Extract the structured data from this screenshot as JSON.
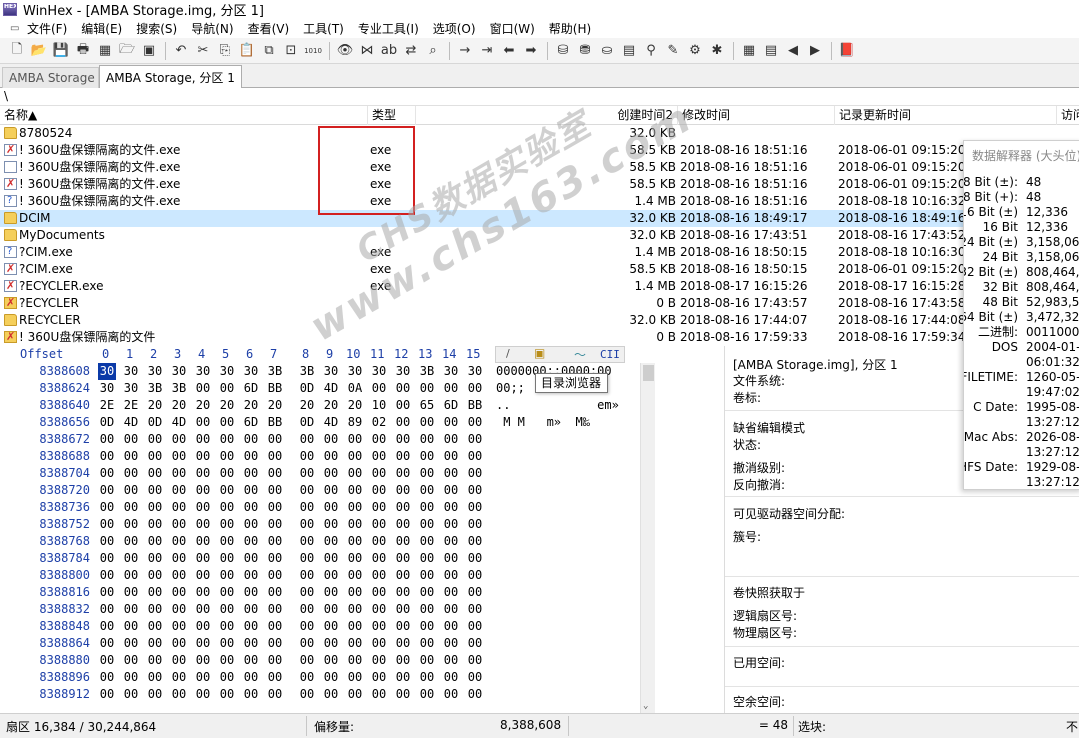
{
  "window": {
    "title": "WinHex - [AMBA Storage.img, 分区 1]",
    "app_icon_text": "HEX"
  },
  "menu": [
    {
      "label": "文件(F)",
      "icon": "file-menu-icon"
    },
    {
      "label": "编辑(E)",
      "icon": ""
    },
    {
      "label": "搜索(S)",
      "icon": ""
    },
    {
      "label": "导航(N)",
      "icon": ""
    },
    {
      "label": "查看(V)",
      "icon": ""
    },
    {
      "label": "工具(T)",
      "icon": ""
    },
    {
      "label": "专业工具(I)",
      "icon": ""
    },
    {
      "label": "选项(O)",
      "icon": ""
    },
    {
      "label": "窗口(W)",
      "icon": ""
    },
    {
      "label": "帮助(H)",
      "icon": ""
    }
  ],
  "toolbar": {
    "icons": [
      "new-file-icon",
      "open-folder-icon",
      "save-icon",
      "print-icon",
      "properties-icon",
      "open-disk-icon",
      "save-all-icon",
      "sep",
      "undo-icon",
      "cut-icon",
      "copy-icon",
      "paste-icon",
      "copy-block-icon",
      "paste-zero-icon",
      "write-hex-icon",
      "sep",
      "find-icon",
      "find-hex-icon",
      "replace-icon",
      "replace-hex-icon",
      "find-all-icon",
      "sep",
      "goto-offset-icon",
      "goto-sector-icon",
      "back-icon",
      "forward-icon",
      "sep",
      "disk-icon",
      "ram-icon",
      "drive-icon",
      "calculator-icon",
      "zoom-icon",
      "tools-icon",
      "hash-icon",
      "gear-icon",
      "sep",
      "grid-icon",
      "table-icon",
      "prev-icon",
      "next-icon",
      "sep",
      "book-icon"
    ],
    "glyphs": [
      "🗋",
      "📂",
      "💾",
      "🖶",
      "▦",
      "🗁",
      "▣",
      "",
      "↶",
      "✂",
      "⎘",
      "📋",
      "⧉",
      "⊡",
      "1010",
      "",
      "👁",
      "⋈",
      "ab",
      "⇄",
      "⌕",
      "",
      "→",
      "⇥",
      "⬅",
      "➡",
      "",
      "⛁",
      "⛃",
      "⛀",
      "▤",
      "⚲",
      "✎",
      "⚙",
      "✱",
      "",
      "▦",
      "▤",
      "◀",
      "▶",
      "",
      "📕"
    ]
  },
  "tabs": [
    {
      "label": "AMBA Storage",
      "active": false
    },
    {
      "label": "AMBA Storage, 分区 1",
      "active": true
    }
  ],
  "path": "\\",
  "filelist": {
    "headers": [
      "名称▲",
      "类型",
      "创建时间2",
      "修改时间",
      "记录更新时间",
      "访问"
    ],
    "rows": [
      {
        "icon": "folder",
        "name": "8780524",
        "type": "",
        "size": "32.0 KB",
        "created": "",
        "modified": "",
        "record": "",
        "sel": false
      },
      {
        "icon": "file-x",
        "name": "! 360U盘保镖隔离的文件.exe",
        "type": "exe",
        "size": "58.5 KB",
        "created": "2018-08-16  18:51:16",
        "modified": "2018-06-01  09:15:20",
        "record": "",
        "sel": false
      },
      {
        "icon": "file",
        "name": "! 360U盘保镖隔离的文件.exe",
        "type": "exe",
        "size": "58.5 KB",
        "created": "2018-08-16  18:51:16",
        "modified": "2018-06-01  09:15:20",
        "record": "",
        "sel": false
      },
      {
        "icon": "file-x",
        "name": "! 360U盘保镖隔离的文件.exe",
        "type": "exe",
        "size": "58.5 KB",
        "created": "2018-08-16  18:51:16",
        "modified": "2018-06-01  09:15:20",
        "record": "",
        "sel": false
      },
      {
        "icon": "file-q",
        "name": "! 360U盘保镖隔离的文件.exe",
        "type": "exe",
        "size": "1.4 MB",
        "created": "2018-08-16  18:51:16",
        "modified": "2018-08-18  10:16:32",
        "record": "",
        "sel": false
      },
      {
        "icon": "folder",
        "name": "DCIM",
        "type": "",
        "size": "32.0 KB",
        "created": "2018-08-16  18:49:17",
        "modified": "2018-08-16  18:49:16",
        "record": "",
        "sel": true
      },
      {
        "icon": "folder",
        "name": "MyDocuments",
        "type": "",
        "size": "32.0 KB",
        "created": "2018-08-16  17:43:51",
        "modified": "2018-08-16  17:43:52",
        "record": "",
        "sel": false
      },
      {
        "icon": "file-q",
        "name": "?CIM.exe",
        "type": "exe",
        "size": "1.4 MB",
        "created": "2018-08-16  18:50:15",
        "modified": "2018-08-18  10:16:30",
        "record": "",
        "sel": false
      },
      {
        "icon": "file-x",
        "name": "?CIM.exe",
        "type": "exe",
        "size": "58.5 KB",
        "created": "2018-08-16  18:50:15",
        "modified": "2018-06-01  09:15:20",
        "record": "",
        "sel": false
      },
      {
        "icon": "file-x",
        "name": "?ECYCLER.exe",
        "type": "exe",
        "size": "1.4 MB",
        "created": "2018-08-17  16:15:26",
        "modified": "2018-08-17  16:15:28",
        "record": "",
        "sel": false
      },
      {
        "icon": "folder-x",
        "name": "?ECYCLER",
        "type": "",
        "size": "0 B",
        "created": "2018-08-16  17:43:57",
        "modified": "2018-08-16  17:43:58",
        "record": "",
        "sel": false
      },
      {
        "icon": "folder",
        "name": "RECYCLER",
        "type": "",
        "size": "32.0 KB",
        "created": "2018-08-16  17:44:07",
        "modified": "2018-08-16  17:44:08",
        "record": "",
        "sel": false
      },
      {
        "icon": "folder-x",
        "name": "! 360U盘保镖隔离的文件",
        "type": "",
        "size": "0 B",
        "created": "2018-08-16  17:59:33",
        "modified": "2018-08-16  17:59:34",
        "record": "",
        "sel": false
      }
    ]
  },
  "watermark": {
    "line1": "CHS数据实验室",
    "line2": "www.chs163.com"
  },
  "hex": {
    "offset_label": "Offset",
    "columns": [
      "0",
      "1",
      "2",
      "3",
      "4",
      "5",
      "6",
      "7",
      "8",
      "9",
      "10",
      "11",
      "12",
      "13",
      "14",
      "15"
    ],
    "rows": [
      {
        "off": "8388608",
        "bytes": [
          "30",
          "30",
          "30",
          "30",
          "30",
          "30",
          "30",
          "3B",
          "3B",
          "30",
          "30",
          "30",
          "30",
          "3B",
          "30",
          "30"
        ],
        "text": "0000000;;0000;00"
      },
      {
        "off": "8388624",
        "bytes": [
          "30",
          "30",
          "3B",
          "3B",
          "00",
          "00",
          "6D",
          "BB",
          "0D",
          "4D",
          "0A",
          "00",
          "00",
          "00",
          "00",
          "00"
        ],
        "text": "00;;"
      },
      {
        "off": "8388640",
        "bytes": [
          "2E",
          "2E",
          "20",
          "20",
          "20",
          "20",
          "20",
          "20",
          "20",
          "20",
          "20",
          "10",
          "00",
          "65",
          "6D",
          "BB"
        ],
        "text": "..            em»"
      },
      {
        "off": "8388656",
        "bytes": [
          "0D",
          "4D",
          "0D",
          "4D",
          "00",
          "00",
          "6D",
          "BB",
          "0D",
          "4D",
          "89",
          "02",
          "00",
          "00",
          "00",
          "00"
        ],
        "text": " M M   m»  M‰"
      },
      {
        "off": "8388672",
        "bytes": [
          "00",
          "00",
          "00",
          "00",
          "00",
          "00",
          "00",
          "00",
          "00",
          "00",
          "00",
          "00",
          "00",
          "00",
          "00",
          "00"
        ],
        "text": ""
      },
      {
        "off": "8388688",
        "bytes": [
          "00",
          "00",
          "00",
          "00",
          "00",
          "00",
          "00",
          "00",
          "00",
          "00",
          "00",
          "00",
          "00",
          "00",
          "00",
          "00"
        ],
        "text": ""
      },
      {
        "off": "8388704",
        "bytes": [
          "00",
          "00",
          "00",
          "00",
          "00",
          "00",
          "00",
          "00",
          "00",
          "00",
          "00",
          "00",
          "00",
          "00",
          "00",
          "00"
        ],
        "text": ""
      },
      {
        "off": "8388720",
        "bytes": [
          "00",
          "00",
          "00",
          "00",
          "00",
          "00",
          "00",
          "00",
          "00",
          "00",
          "00",
          "00",
          "00",
          "00",
          "00",
          "00"
        ],
        "text": ""
      },
      {
        "off": "8388736",
        "bytes": [
          "00",
          "00",
          "00",
          "00",
          "00",
          "00",
          "00",
          "00",
          "00",
          "00",
          "00",
          "00",
          "00",
          "00",
          "00",
          "00"
        ],
        "text": ""
      },
      {
        "off": "8388752",
        "bytes": [
          "00",
          "00",
          "00",
          "00",
          "00",
          "00",
          "00",
          "00",
          "00",
          "00",
          "00",
          "00",
          "00",
          "00",
          "00",
          "00"
        ],
        "text": ""
      },
      {
        "off": "8388768",
        "bytes": [
          "00",
          "00",
          "00",
          "00",
          "00",
          "00",
          "00",
          "00",
          "00",
          "00",
          "00",
          "00",
          "00",
          "00",
          "00",
          "00"
        ],
        "text": ""
      },
      {
        "off": "8388784",
        "bytes": [
          "00",
          "00",
          "00",
          "00",
          "00",
          "00",
          "00",
          "00",
          "00",
          "00",
          "00",
          "00",
          "00",
          "00",
          "00",
          "00"
        ],
        "text": ""
      },
      {
        "off": "8388800",
        "bytes": [
          "00",
          "00",
          "00",
          "00",
          "00",
          "00",
          "00",
          "00",
          "00",
          "00",
          "00",
          "00",
          "00",
          "00",
          "00",
          "00"
        ],
        "text": ""
      },
      {
        "off": "8388816",
        "bytes": [
          "00",
          "00",
          "00",
          "00",
          "00",
          "00",
          "00",
          "00",
          "00",
          "00",
          "00",
          "00",
          "00",
          "00",
          "00",
          "00"
        ],
        "text": ""
      },
      {
        "off": "8388832",
        "bytes": [
          "00",
          "00",
          "00",
          "00",
          "00",
          "00",
          "00",
          "00",
          "00",
          "00",
          "00",
          "00",
          "00",
          "00",
          "00",
          "00"
        ],
        "text": ""
      },
      {
        "off": "8388848",
        "bytes": [
          "00",
          "00",
          "00",
          "00",
          "00",
          "00",
          "00",
          "00",
          "00",
          "00",
          "00",
          "00",
          "00",
          "00",
          "00",
          "00"
        ],
        "text": ""
      },
      {
        "off": "8388864",
        "bytes": [
          "00",
          "00",
          "00",
          "00",
          "00",
          "00",
          "00",
          "00",
          "00",
          "00",
          "00",
          "00",
          "00",
          "00",
          "00",
          "00"
        ],
        "text": ""
      },
      {
        "off": "8388880",
        "bytes": [
          "00",
          "00",
          "00",
          "00",
          "00",
          "00",
          "00",
          "00",
          "00",
          "00",
          "00",
          "00",
          "00",
          "00",
          "00",
          "00"
        ],
        "text": ""
      },
      {
        "off": "8388896",
        "bytes": [
          "00",
          "00",
          "00",
          "00",
          "00",
          "00",
          "00",
          "00",
          "00",
          "00",
          "00",
          "00",
          "00",
          "00",
          "00",
          "00"
        ],
        "text": ""
      },
      {
        "off": "8388912",
        "bytes": [
          "00",
          "00",
          "00",
          "00",
          "00",
          "00",
          "00",
          "00",
          "00",
          "00",
          "00",
          "00",
          "00",
          "00",
          "00",
          "00"
        ],
        "text": ""
      }
    ],
    "mini_header": "CII",
    "tooltip": "目录浏览器"
  },
  "info": {
    "rows": [
      {
        "label": "[AMBA Storage.img], 分区 1"
      },
      {
        "label": "文件系统:"
      },
      {
        "label": "卷标:"
      },
      {
        "label": "缺省编辑模式"
      },
      {
        "label": "状态:"
      },
      {
        "label": "撤消级别:"
      },
      {
        "label": "反向撤消:"
      },
      {
        "label": "可见驱动器空间分配:"
      },
      {
        "label": "簇号:"
      },
      {
        "label": "卷快照获取于"
      },
      {
        "label": "逻辑扇区号:"
      },
      {
        "label": "物理扇区号:"
      },
      {
        "label": "已用空间:"
      },
      {
        "label": "空余空间:"
      }
    ]
  },
  "interpreter": {
    "title": "数据解释器 (大头位)",
    "rows": [
      {
        "label": "8 Bit (±):",
        "value": "48"
      },
      {
        "label": "8 Bit (+):",
        "value": "48"
      },
      {
        "label": "16 Bit (±)",
        "value": "12,336"
      },
      {
        "label": "16 Bit",
        "value": "12,336"
      },
      {
        "label": "24 Bit (±)",
        "value": "3,158,064"
      },
      {
        "label": "24 Bit",
        "value": "3,158,064"
      },
      {
        "label": "32 Bit (±)",
        "value": "808,464,4"
      },
      {
        "label": "32 Bit",
        "value": "808,464,4"
      },
      {
        "label": "48 Bit",
        "value": "52,983,52"
      },
      {
        "label": "64 Bit (±)",
        "value": "3,472,328"
      },
      {
        "label": "二进制:",
        "value": "00110000"
      },
      {
        "label": "DOS",
        "value": "2004-01-"
      },
      {
        "label": "",
        "value": "06:01:32"
      },
      {
        "label": "FILETIME:",
        "value": "1260-05-"
      },
      {
        "label": "",
        "value": "19:47:02"
      },
      {
        "label": "C Date:",
        "value": "1995-08-"
      },
      {
        "label": "",
        "value": "13:27:12"
      },
      {
        "label": "Mac Abs:",
        "value": "2026-08-"
      },
      {
        "label": "",
        "value": "13:27:12"
      },
      {
        "label": "HFS Date:",
        "value": "1929-08-"
      },
      {
        "label": "",
        "value": "13:27:12"
      }
    ]
  },
  "status": {
    "sector": "扇区 16,384 / 30,244,864",
    "offset_label": "偏移量:",
    "offset_value": "8,388,608",
    "value": "= 48",
    "block_label": "选块:",
    "right": "不"
  }
}
